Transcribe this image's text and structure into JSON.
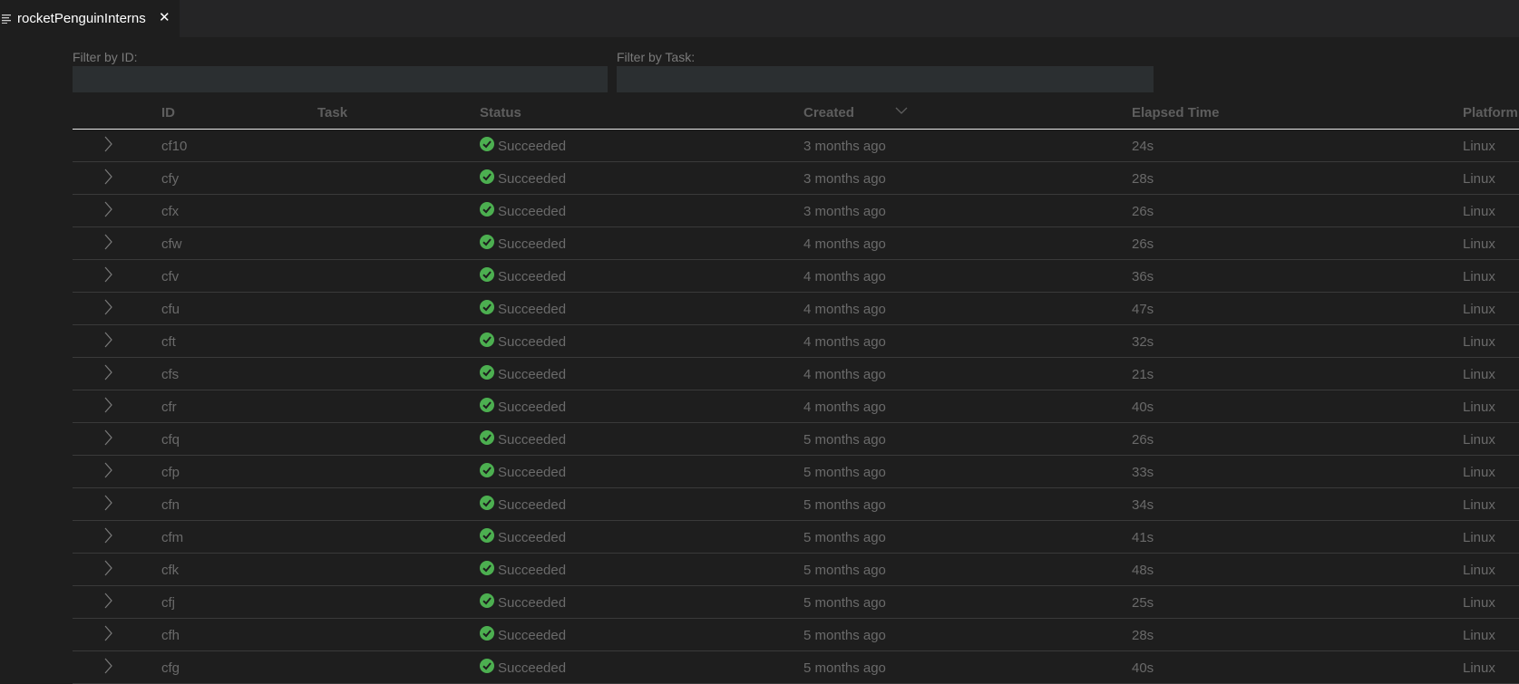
{
  "tab": {
    "title": "rocketPenguinInterns",
    "close_glyph": "✕"
  },
  "filters": {
    "id_label": "Filter by ID:",
    "id_value": "",
    "task_label": "Filter by Task:",
    "task_value": ""
  },
  "columns": {
    "id": "ID",
    "task": "Task",
    "status": "Status",
    "created": "Created",
    "elapsed": "Elapsed Time",
    "platform": "Platform"
  },
  "sort": {
    "column": "Created",
    "direction": "descending",
    "icon": "chevron-down-icon"
  },
  "colors": {
    "success": "#4caf50",
    "background": "#1e1e1e",
    "tabbar": "#252526",
    "input": "#2b2f31"
  },
  "rows": [
    {
      "id": "cf10",
      "task": "",
      "status": "Succeeded",
      "created": "3 months ago",
      "elapsed": "24s",
      "platform": "Linux"
    },
    {
      "id": "cfy",
      "task": "",
      "status": "Succeeded",
      "created": "3 months ago",
      "elapsed": "28s",
      "platform": "Linux"
    },
    {
      "id": "cfx",
      "task": "",
      "status": "Succeeded",
      "created": "3 months ago",
      "elapsed": "26s",
      "platform": "Linux"
    },
    {
      "id": "cfw",
      "task": "",
      "status": "Succeeded",
      "created": "4 months ago",
      "elapsed": "26s",
      "platform": "Linux"
    },
    {
      "id": "cfv",
      "task": "",
      "status": "Succeeded",
      "created": "4 months ago",
      "elapsed": "36s",
      "platform": "Linux"
    },
    {
      "id": "cfu",
      "task": "",
      "status": "Succeeded",
      "created": "4 months ago",
      "elapsed": "47s",
      "platform": "Linux"
    },
    {
      "id": "cft",
      "task": "",
      "status": "Succeeded",
      "created": "4 months ago",
      "elapsed": "32s",
      "platform": "Linux"
    },
    {
      "id": "cfs",
      "task": "",
      "status": "Succeeded",
      "created": "4 months ago",
      "elapsed": "21s",
      "platform": "Linux"
    },
    {
      "id": "cfr",
      "task": "",
      "status": "Succeeded",
      "created": "4 months ago",
      "elapsed": "40s",
      "platform": "Linux"
    },
    {
      "id": "cfq",
      "task": "",
      "status": "Succeeded",
      "created": "5 months ago",
      "elapsed": "26s",
      "platform": "Linux"
    },
    {
      "id": "cfp",
      "task": "",
      "status": "Succeeded",
      "created": "5 months ago",
      "elapsed": "33s",
      "platform": "Linux"
    },
    {
      "id": "cfn",
      "task": "",
      "status": "Succeeded",
      "created": "5 months ago",
      "elapsed": "34s",
      "platform": "Linux"
    },
    {
      "id": "cfm",
      "task": "",
      "status": "Succeeded",
      "created": "5 months ago",
      "elapsed": "41s",
      "platform": "Linux"
    },
    {
      "id": "cfk",
      "task": "",
      "status": "Succeeded",
      "created": "5 months ago",
      "elapsed": "48s",
      "platform": "Linux"
    },
    {
      "id": "cfj",
      "task": "",
      "status": "Succeeded",
      "created": "5 months ago",
      "elapsed": "25s",
      "platform": "Linux"
    },
    {
      "id": "cfh",
      "task": "",
      "status": "Succeeded",
      "created": "5 months ago",
      "elapsed": "28s",
      "platform": "Linux"
    },
    {
      "id": "cfg",
      "task": "",
      "status": "Succeeded",
      "created": "5 months ago",
      "elapsed": "40s",
      "platform": "Linux"
    }
  ]
}
